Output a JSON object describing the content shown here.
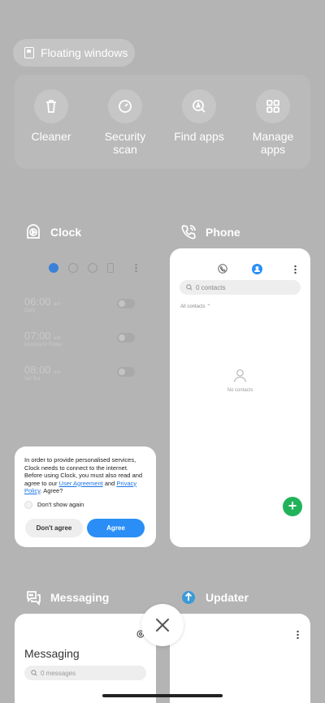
{
  "floating_windows": {
    "label": "Floating windows",
    "icon": "floating-window-icon"
  },
  "tools": [
    {
      "label": "Cleaner",
      "icon": "trash-icon"
    },
    {
      "label": "Security\nscan",
      "icon": "security-icon"
    },
    {
      "label": "Find apps",
      "icon": "find-apps-icon"
    },
    {
      "label": "Manage\napps",
      "icon": "grid-icon"
    }
  ],
  "apps": {
    "clock": {
      "name": "Clock",
      "alarms": [
        {
          "time": "06:00",
          "ampm": "am",
          "repeat": "Daily"
        },
        {
          "time": "07:00",
          "ampm": "am",
          "repeat": "Monday to Friday"
        },
        {
          "time": "08:00",
          "ampm": "am",
          "repeat": "Set Bot"
        }
      ],
      "dialog": {
        "text_before": "In order to provide personalised services, Clock needs to connect to the internet. Before using Clock, you must also read and agree to our ",
        "link1": "User Agreement",
        "and": " and ",
        "link2": "Privacy Policy",
        "text_after": ". Agree?",
        "checkbox_label": "Don't show again",
        "disagree": "Don't agree",
        "agree": "Agree"
      }
    },
    "phone": {
      "name": "Phone",
      "search_placeholder": "0 contacts",
      "filter": "All contacts",
      "empty": "No contacts",
      "fab": "+"
    },
    "messaging": {
      "name": "Messaging",
      "title": "Messaging",
      "search_placeholder": "0 messages"
    },
    "updater": {
      "name": "Updater"
    }
  },
  "colors": {
    "accent": "#2a8ef6",
    "fab": "#21b35a",
    "overlay": "#b4b4b4"
  }
}
